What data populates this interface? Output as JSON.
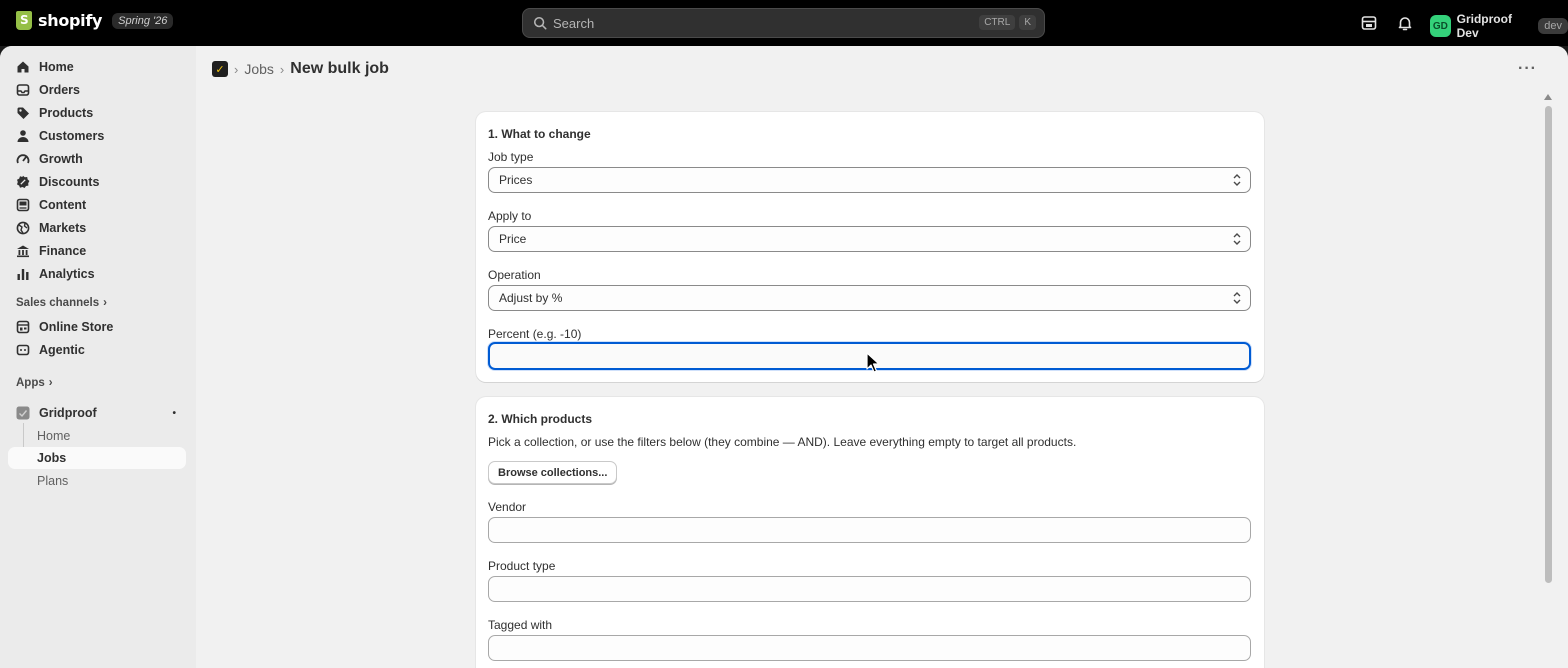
{
  "topbar": {
    "brand": "shopify",
    "edition_badge": "Spring '26",
    "search_placeholder": "Search",
    "shortcut_keys": [
      "CTRL",
      "K"
    ],
    "user_initials": "GD",
    "user_name": "Gridproof Dev",
    "user_tag": "dev",
    "icons": [
      "store-icon",
      "bell-icon"
    ]
  },
  "sidebar": {
    "items": [
      {
        "label": "Home",
        "icon": "home-icon"
      },
      {
        "label": "Orders",
        "icon": "orders-icon"
      },
      {
        "label": "Products",
        "icon": "tag-icon"
      },
      {
        "label": "Customers",
        "icon": "person-icon"
      },
      {
        "label": "Growth",
        "icon": "growth-icon"
      },
      {
        "label": "Discounts",
        "icon": "discount-icon"
      },
      {
        "label": "Content",
        "icon": "content-icon"
      },
      {
        "label": "Markets",
        "icon": "globe-icon"
      },
      {
        "label": "Finance",
        "icon": "bank-icon"
      },
      {
        "label": "Analytics",
        "icon": "chart-icon"
      }
    ],
    "sales_channels_label": "Sales channels",
    "channels": [
      {
        "label": "Online Store",
        "icon": "store-icon"
      },
      {
        "label": "Agentic",
        "icon": "agent-icon"
      }
    ],
    "apps_label": "Apps",
    "app": {
      "label": "Gridproof",
      "icon": "gridproof-app-icon"
    },
    "app_pages": [
      {
        "label": "Home",
        "active": false
      },
      {
        "label": "Jobs",
        "active": true
      },
      {
        "label": "Plans",
        "active": false
      }
    ]
  },
  "page": {
    "breadcrumb_parent": "Jobs",
    "title": "New bulk job"
  },
  "section1": {
    "heading": "1. What to change",
    "job_type_label": "Job type",
    "job_type_value": "Prices",
    "apply_to_label": "Apply to",
    "apply_to_value": "Price",
    "operation_label": "Operation",
    "operation_value": "Adjust by %",
    "percent_label": "Percent (e.g. -10)",
    "percent_value": ""
  },
  "section2": {
    "heading": "2. Which products",
    "description": "Pick a collection, or use the filters below (they combine — AND). Leave everything empty to target all products.",
    "browse_button": "Browse collections...",
    "vendor_label": "Vendor",
    "vendor_value": "",
    "product_type_label": "Product type",
    "product_type_value": "",
    "tagged_with_label": "Tagged with",
    "tagged_with_value": ""
  },
  "colors": {
    "focus_border": "#005bd3",
    "avatar_bg": "#34d17a",
    "topbar_bg": "#000000"
  }
}
